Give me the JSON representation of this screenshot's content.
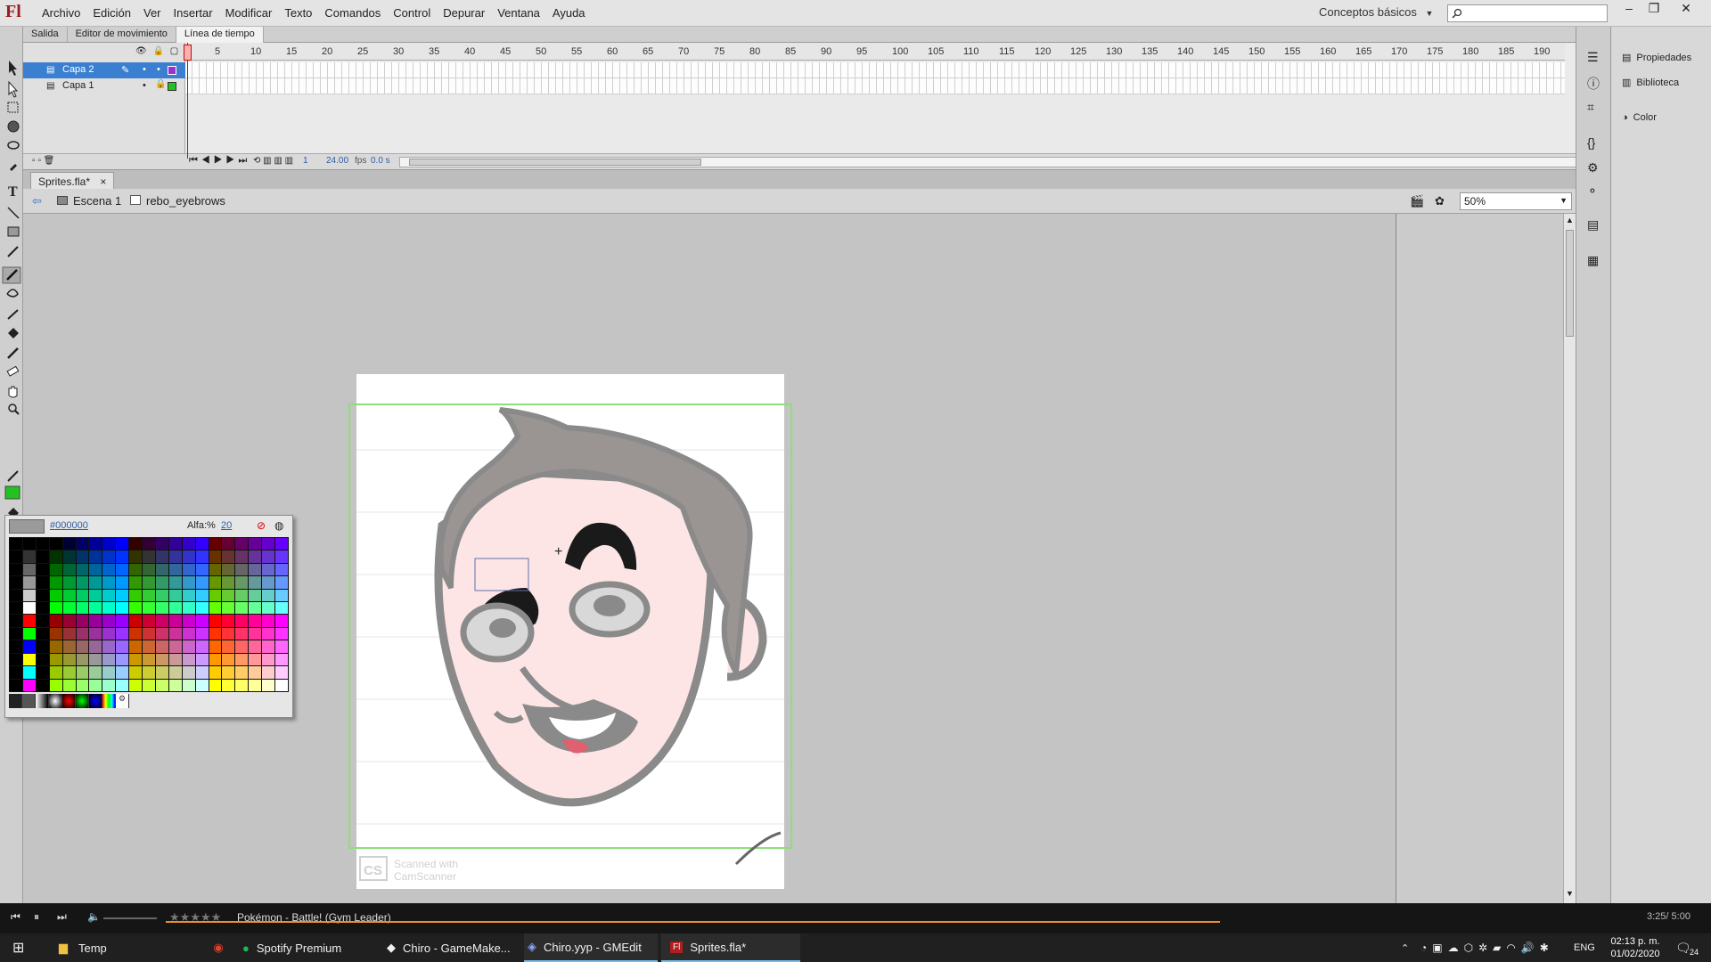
{
  "app": {
    "logo_text": "Fl",
    "menu": [
      "Archivo",
      "Edición",
      "Ver",
      "Insertar",
      "Modificar",
      "Texto",
      "Comandos",
      "Control",
      "Depurar",
      "Ventana",
      "Ayuda"
    ],
    "workspace": "Conceptos básicos"
  },
  "panel_tabs": [
    "Salida",
    "Editor de movimiento",
    "Línea de tiempo"
  ],
  "timeline": {
    "layers": [
      {
        "name": "Capa 2",
        "selected": true,
        "color": "#9b30d4"
      },
      {
        "name": "Capa 1",
        "selected": false,
        "color": "#22c222"
      }
    ],
    "ruler_numbers": [
      "1",
      "5",
      "10",
      "15",
      "20",
      "25",
      "30",
      "35",
      "40",
      "45",
      "50",
      "55",
      "60",
      "65",
      "70",
      "75",
      "80",
      "85",
      "90",
      "95",
      "100",
      "105",
      "110",
      "115",
      "120",
      "125",
      "130",
      "135",
      "140",
      "145",
      "150",
      "155",
      "160",
      "165",
      "170",
      "175",
      "180",
      "185",
      "190"
    ],
    "current_frame": "1",
    "fps": "24.00",
    "fps_unit": "fps",
    "time": "0.0 s"
  },
  "document": {
    "tab_name": "Sprites.fla*",
    "close_glyph": "×",
    "breadcrumb": [
      "Escena 1",
      "rebo_eyebrows"
    ],
    "zoom": "50%"
  },
  "stage": {
    "watermark_line1": "Scanned with",
    "watermark_line2": "CamScanner",
    "watermark_logo": "CS"
  },
  "swatches": {
    "hex": "#000000",
    "alpha_label": "Alfa:%",
    "alpha_value": "20"
  },
  "right_panel": {
    "items": [
      "Propiedades",
      "Biblioteca",
      "Color"
    ]
  },
  "media_player": {
    "track": "Pokémon - Battle! (Gym Leader)",
    "time": "3:25/ 5:00",
    "stars": "★★★★★",
    "progress": 0.68
  },
  "taskbar": {
    "items": [
      {
        "label": "Temp",
        "icon": "folder-icon",
        "active": false
      },
      {
        "label": "",
        "icon": "chrome-icon",
        "active": false
      },
      {
        "label": "Spotify Premium",
        "icon": "spotify-icon",
        "active": false
      },
      {
        "label": "Chiro - GameMake...",
        "icon": "gamemaker-icon",
        "active": false
      },
      {
        "label": "Chiro.yyp - GMEdit",
        "icon": "gmedit-icon",
        "active": true
      },
      {
        "label": "Sprites.fla*",
        "icon": "flash-icon",
        "active": true
      }
    ],
    "language": "ENG",
    "time": "02:13 p. m.",
    "date": "01/02/2020",
    "notifications": "24"
  }
}
